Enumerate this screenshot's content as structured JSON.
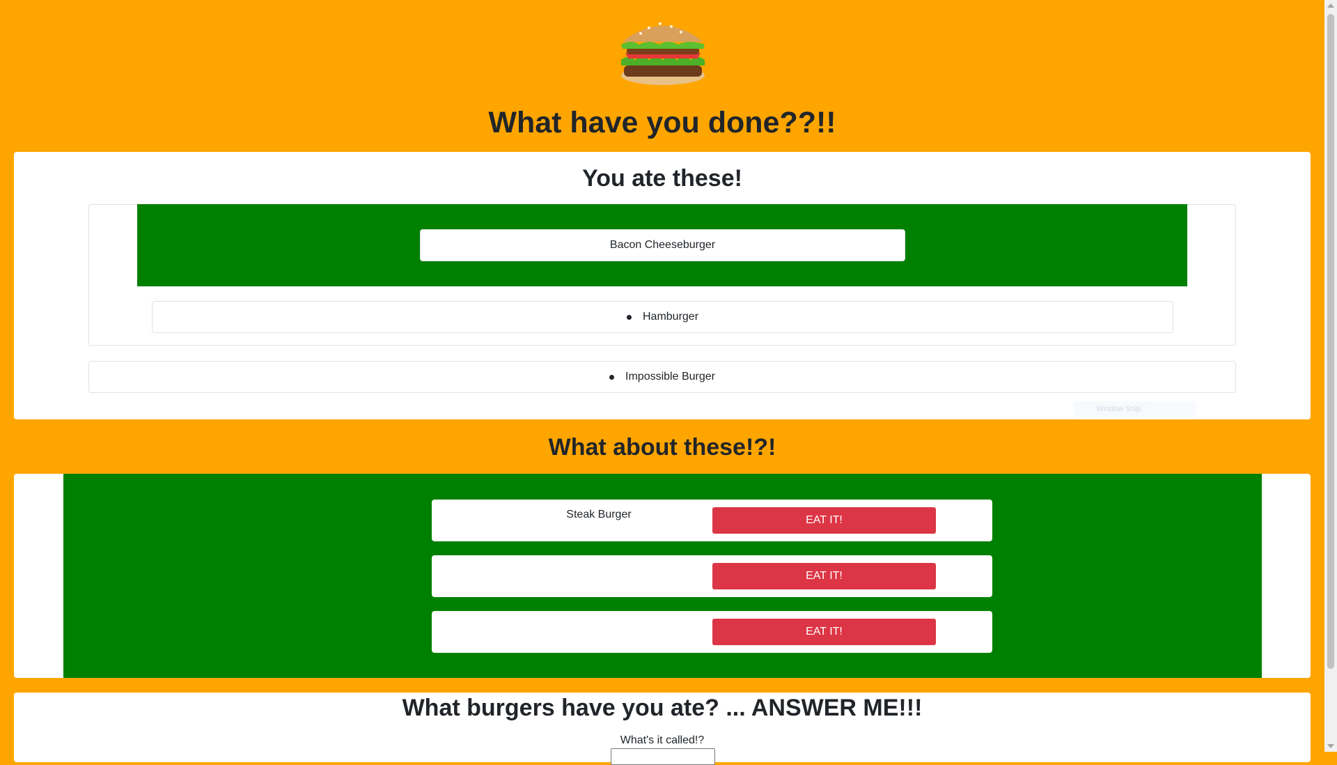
{
  "header": {
    "logo_icon": "burger-icon",
    "title": "What have you done??!!"
  },
  "eaten": {
    "title": "You ate these!",
    "items": [
      {
        "name": "Bacon Cheeseburger"
      },
      {
        "name": "Hamburger"
      },
      {
        "name": "Impossible Burger"
      }
    ],
    "overlay_label": "Window Snip"
  },
  "uneaten": {
    "title": "What about these!?!",
    "burgers": [
      {
        "name": "Steak Burger",
        "button": "EAT IT!"
      },
      {
        "name": "",
        "button": "EAT IT!"
      },
      {
        "name": "",
        "button": "EAT IT!"
      }
    ]
  },
  "form": {
    "title": "What burgers have you ate? ... ANSWER ME!!!",
    "field_label": "What's it called!?",
    "field_value": ""
  },
  "colors": {
    "background": "#ffa500",
    "highlight_band": "#008000",
    "eat_button": "#dc3545"
  }
}
